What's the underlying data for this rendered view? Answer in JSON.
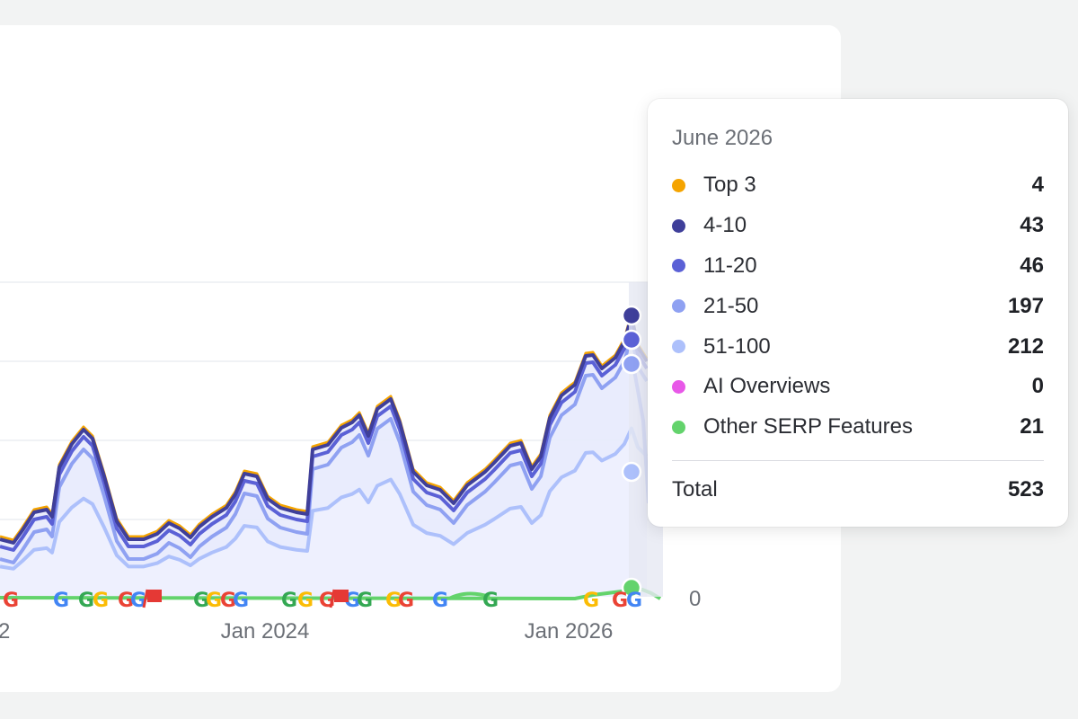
{
  "chart_data": {
    "type": "area",
    "x_tick_labels": [
      "2",
      "Jan 2024",
      "Jan 2026"
    ],
    "y_tick_labels": [
      "0"
    ],
    "series": [
      {
        "name": "Top 3",
        "color": "#f5a400"
      },
      {
        "name": "4-10",
        "color": "#3f3f9a"
      },
      {
        "name": "11-20",
        "color": "#5b61d6"
      },
      {
        "name": "21-50",
        "color": "#8fa1f2"
      },
      {
        "name": "51-100",
        "color": "#adc0fb"
      },
      {
        "name": "AI Overviews",
        "color": "#e858e8"
      },
      {
        "name": "Other SERP Features",
        "color": "#63d36c"
      }
    ],
    "hover_point": {
      "date": "June 2026",
      "values": {
        "Top 3": 4,
        "4-10": 43,
        "11-20": 46,
        "21-50": 197,
        "51-100": 212,
        "AI Overviews": 0,
        "Other SERP Features": 21
      },
      "total": 523
    },
    "serp_marker_icons": [
      "google-icon",
      "flag-icon"
    ],
    "grid": true
  },
  "tooltip": {
    "title": "June 2026",
    "rows": [
      {
        "label": "Top 3",
        "value": "4",
        "color": "#f5a400"
      },
      {
        "label": "4-10",
        "value": "43",
        "color": "#3f3f9a"
      },
      {
        "label": "11-20",
        "value": "46",
        "color": "#5b61d6"
      },
      {
        "label": "21-50",
        "value": "197",
        "color": "#8fa1f2"
      },
      {
        "label": "51-100",
        "value": "212",
        "color": "#adc0fb"
      },
      {
        "label": "AI Overviews",
        "value": "0",
        "color": "#e858e8"
      },
      {
        "label": "Other SERP Features",
        "value": "21",
        "color": "#63d36c"
      }
    ],
    "total_label": "Total",
    "total_value": "523"
  }
}
